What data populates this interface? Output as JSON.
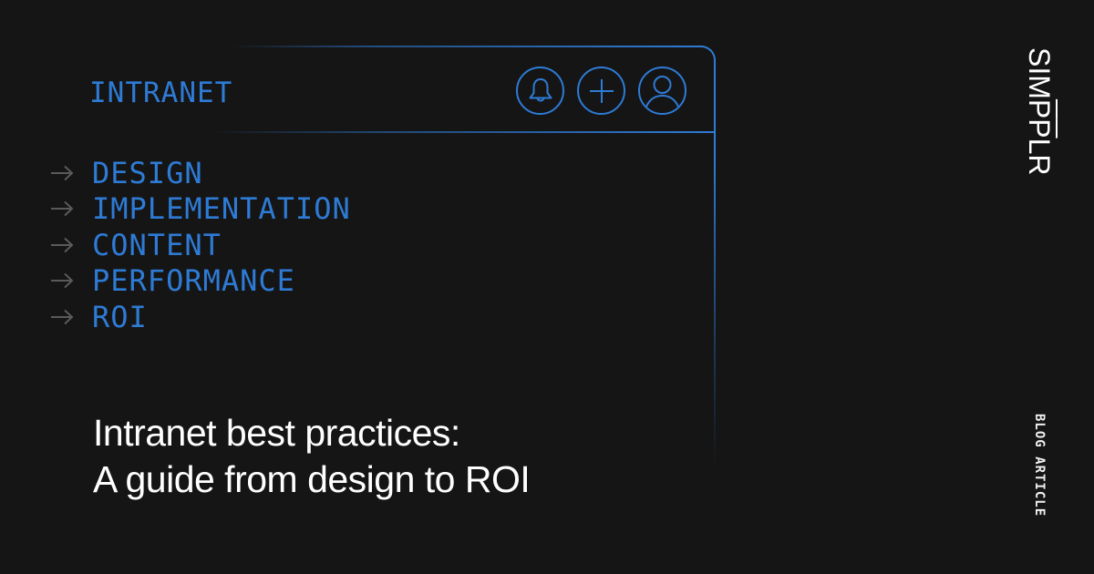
{
  "colors": {
    "background": "#151515",
    "accent": "#2e7bd6",
    "arrow": "#5a5a5a",
    "headline": "#ffffff"
  },
  "window": {
    "title": "INTRANET",
    "header_icons": [
      {
        "name": "bell-icon",
        "label": "Notifications"
      },
      {
        "name": "plus-icon",
        "label": "Add"
      },
      {
        "name": "user-icon",
        "label": "Profile"
      }
    ]
  },
  "menu": {
    "arrow_icon": "arrow-right-icon",
    "items": [
      {
        "label": "DESIGN"
      },
      {
        "label": "IMPLEMENTATION"
      },
      {
        "label": "CONTENT"
      },
      {
        "label": "PERFORMANCE"
      },
      {
        "label": "ROI"
      }
    ]
  },
  "headline": {
    "line1": "Intranet best practices:",
    "line2": "A guide from design to ROI"
  },
  "brand": {
    "logo_parts": [
      "SIM",
      "P",
      "P",
      "LR"
    ]
  },
  "badge": {
    "label": "BLOG ARTICLE"
  }
}
